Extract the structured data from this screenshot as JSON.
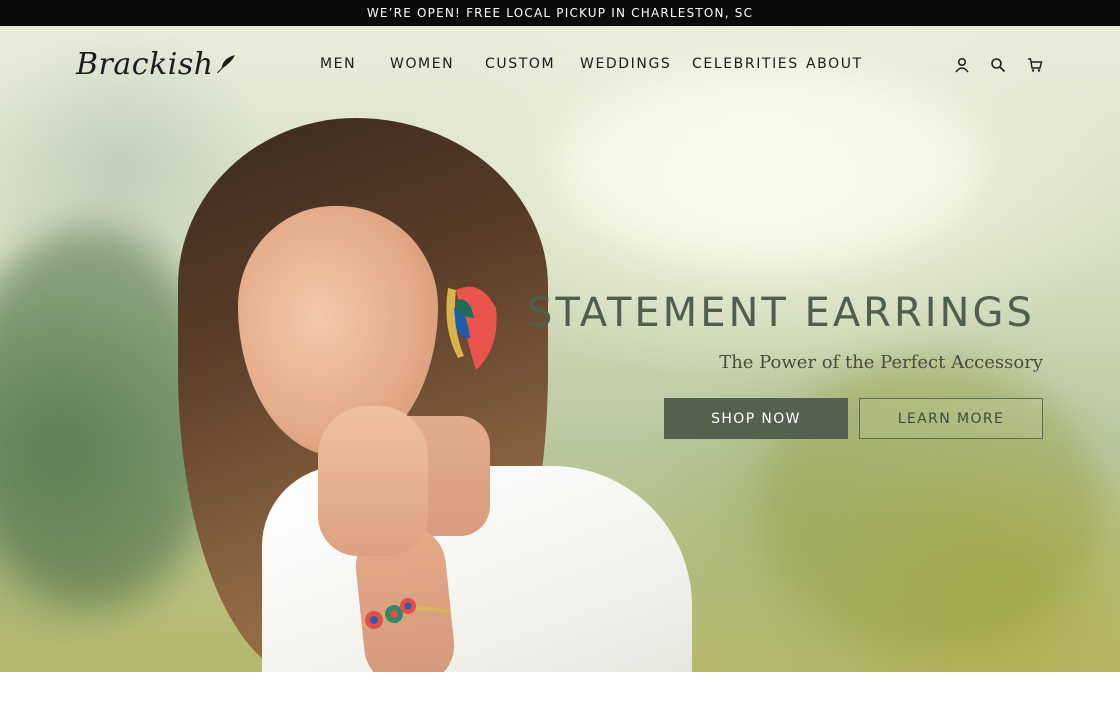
{
  "announcement": "WE’RE OPEN! FREE LOCAL PICKUP IN CHARLESTON, SC",
  "brand": {
    "logo_text": "Brackish",
    "logo_icon": "feather-icon"
  },
  "nav": {
    "items": [
      {
        "label": "MEN"
      },
      {
        "label": "WOMEN"
      },
      {
        "label": "CUSTOM"
      },
      {
        "label": "WEDDINGS"
      },
      {
        "label": "CELEBRITIES"
      },
      {
        "label": "ABOUT"
      }
    ],
    "utility_icons": [
      "account-icon",
      "search-icon",
      "cart-icon"
    ]
  },
  "hero": {
    "headline": "STATEMENT EARRINGS",
    "subheadline": "The Power of the Perfect Accessory",
    "primary_button": "SHOP NOW",
    "secondary_button": "LEARN MORE"
  },
  "colors": {
    "announcement_bg": "#0b0b0b",
    "headline": "#4f5e4f",
    "primary_button_bg": "#55604f"
  }
}
